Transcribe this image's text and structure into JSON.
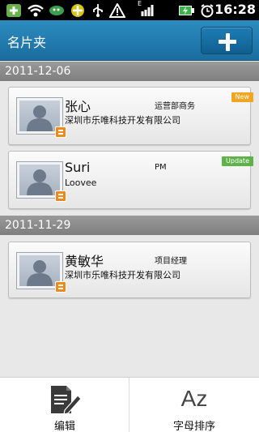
{
  "statusbar": {
    "time": "16:28",
    "network_label": "E"
  },
  "header": {
    "title": "名片夹",
    "add_button_icon": "plus-icon"
  },
  "sections": [
    {
      "date": "2011-12-06",
      "cards": [
        {
          "name": "张心",
          "role": "运营部商务",
          "company": "深圳市乐唯科技开发有限公司",
          "tag": "New"
        },
        {
          "name": "Suri",
          "role": "PM",
          "company": "Loovee",
          "tag": "Update"
        }
      ]
    },
    {
      "date": "2011-11-29",
      "cards": [
        {
          "name": "黄敏华",
          "role": "项目经理",
          "company": "深圳市乐唯科技开发有限公司",
          "tag": ""
        }
      ]
    }
  ],
  "bottom": {
    "edit_label": "编辑",
    "sort_label": "字母排序",
    "sort_icon_text": "Az"
  },
  "colors": {
    "header": "#1a6c9e",
    "new_tag": "#f1a521",
    "update_tag": "#5fb14a",
    "badge": "#f08a1c"
  }
}
